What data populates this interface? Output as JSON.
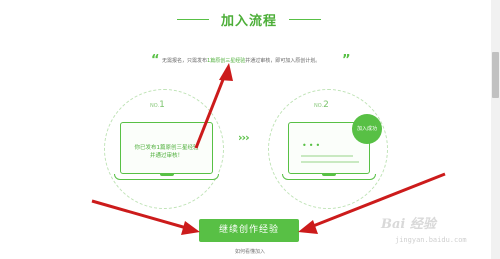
{
  "header": {
    "title": "加入流程"
  },
  "intro": {
    "open_quote": "“",
    "close_quote": "”",
    "text_before": "无需报名，只需发布",
    "text_highlight": "1篇原创三星经验",
    "text_after": "并通过审核，即可加入原创计划。"
  },
  "steps": [
    {
      "label_prefix": "NO.",
      "number": "1",
      "text_line1": "你已发布1篇原创三星经验",
      "text_line2": "并通过审核！"
    },
    {
      "label_prefix": "NO.",
      "number": "2",
      "badge": "加入成功"
    }
  ],
  "connector": "›››",
  "action": {
    "button_label": "继续创作经验",
    "sub_link": "如何看懂加入"
  },
  "watermark": {
    "logo_text": "Bai 经验",
    "url": "jingyan.baidu.com"
  },
  "colors": {
    "accent": "#58c045",
    "annotation_arrow": "#cc1b1b"
  }
}
